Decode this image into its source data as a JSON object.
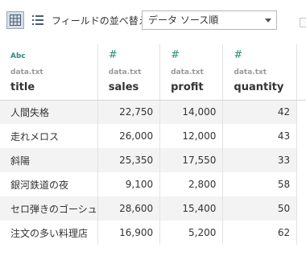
{
  "toolbar": {
    "grid_view_icon": "grid-icon",
    "list_view_icon": "list-icon",
    "sort_label": "フィールドの並べ替え",
    "sort_value": "データ ソース順"
  },
  "columns": [
    {
      "type_icon": "Abc",
      "source": "data.txt",
      "name": "title"
    },
    {
      "type_icon": "#",
      "source": "data.txt",
      "name": "sales"
    },
    {
      "type_icon": "#",
      "source": "data.txt",
      "name": "profit"
    },
    {
      "type_icon": "#",
      "source": "data.txt",
      "name": "quantity"
    }
  ],
  "rows": [
    {
      "title": "人間失格",
      "sales": "22,750",
      "profit": "14,000",
      "quantity": "42"
    },
    {
      "title": "走れメロス",
      "sales": "26,000",
      "profit": "12,000",
      "quantity": "43"
    },
    {
      "title": "斜陽",
      "sales": "25,350",
      "profit": "17,550",
      "quantity": "33"
    },
    {
      "title": "銀河鉄道の夜",
      "sales": "9,100",
      "profit": "2,800",
      "quantity": "58"
    },
    {
      "title": "セロ弾きのゴーシュ",
      "sales": "28,600",
      "profit": "15,400",
      "quantity": "50"
    },
    {
      "title": "注文の多い料理店",
      "sales": "16,900",
      "profit": "5,200",
      "quantity": "62"
    }
  ],
  "colors": {
    "accent": "#2e8b7a",
    "alt_row": "#f3f3f3"
  }
}
